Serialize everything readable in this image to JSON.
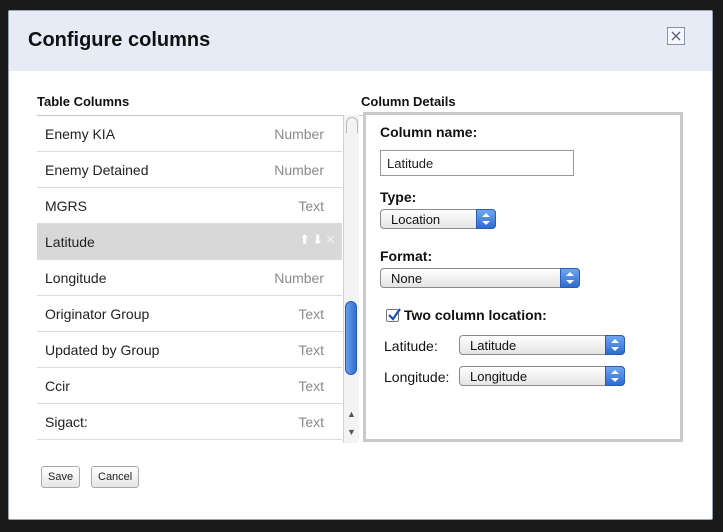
{
  "dialog": {
    "title": "Configure columns",
    "close_icon": "close-icon"
  },
  "table_columns": {
    "header": "Table Columns",
    "rows": [
      {
        "name": "Enemy KIA",
        "type": "Number",
        "selected": false
      },
      {
        "name": "Enemy Detained",
        "type": "Number",
        "selected": false
      },
      {
        "name": "MGRS",
        "type": "Text",
        "selected": false
      },
      {
        "name": "Latitude",
        "type": "",
        "selected": true,
        "controls": [
          "move-up-icon",
          "move-down-icon",
          "delete-icon"
        ]
      },
      {
        "name": "Longitude",
        "type": "Number",
        "selected": false
      },
      {
        "name": "Originator Group",
        "type": "Text",
        "selected": false
      },
      {
        "name": "Updated by Group",
        "type": "Text",
        "selected": false
      },
      {
        "name": "Ccir",
        "type": "Text",
        "selected": false
      },
      {
        "name": "Sigact:",
        "type": "Text",
        "selected": false
      }
    ]
  },
  "column_details": {
    "header": "Column Details",
    "name_label": "Column name:",
    "name_value": "Latitude",
    "type_label": "Type:",
    "type_value": "Location",
    "format_label": "Format:",
    "format_value": "None",
    "two_column_label": "Two column location:",
    "two_column_checked": true,
    "latitude_label": "Latitude:",
    "latitude_value": "Latitude",
    "longitude_label": "Longitude:",
    "longitude_value": "Longitude"
  },
  "footer": {
    "save_label": "Save",
    "cancel_label": "Cancel"
  },
  "colors": {
    "title_bar": "#e7ebf6",
    "selected_row": "#d8d8d8",
    "accent_blue": "#2d6bd3"
  }
}
